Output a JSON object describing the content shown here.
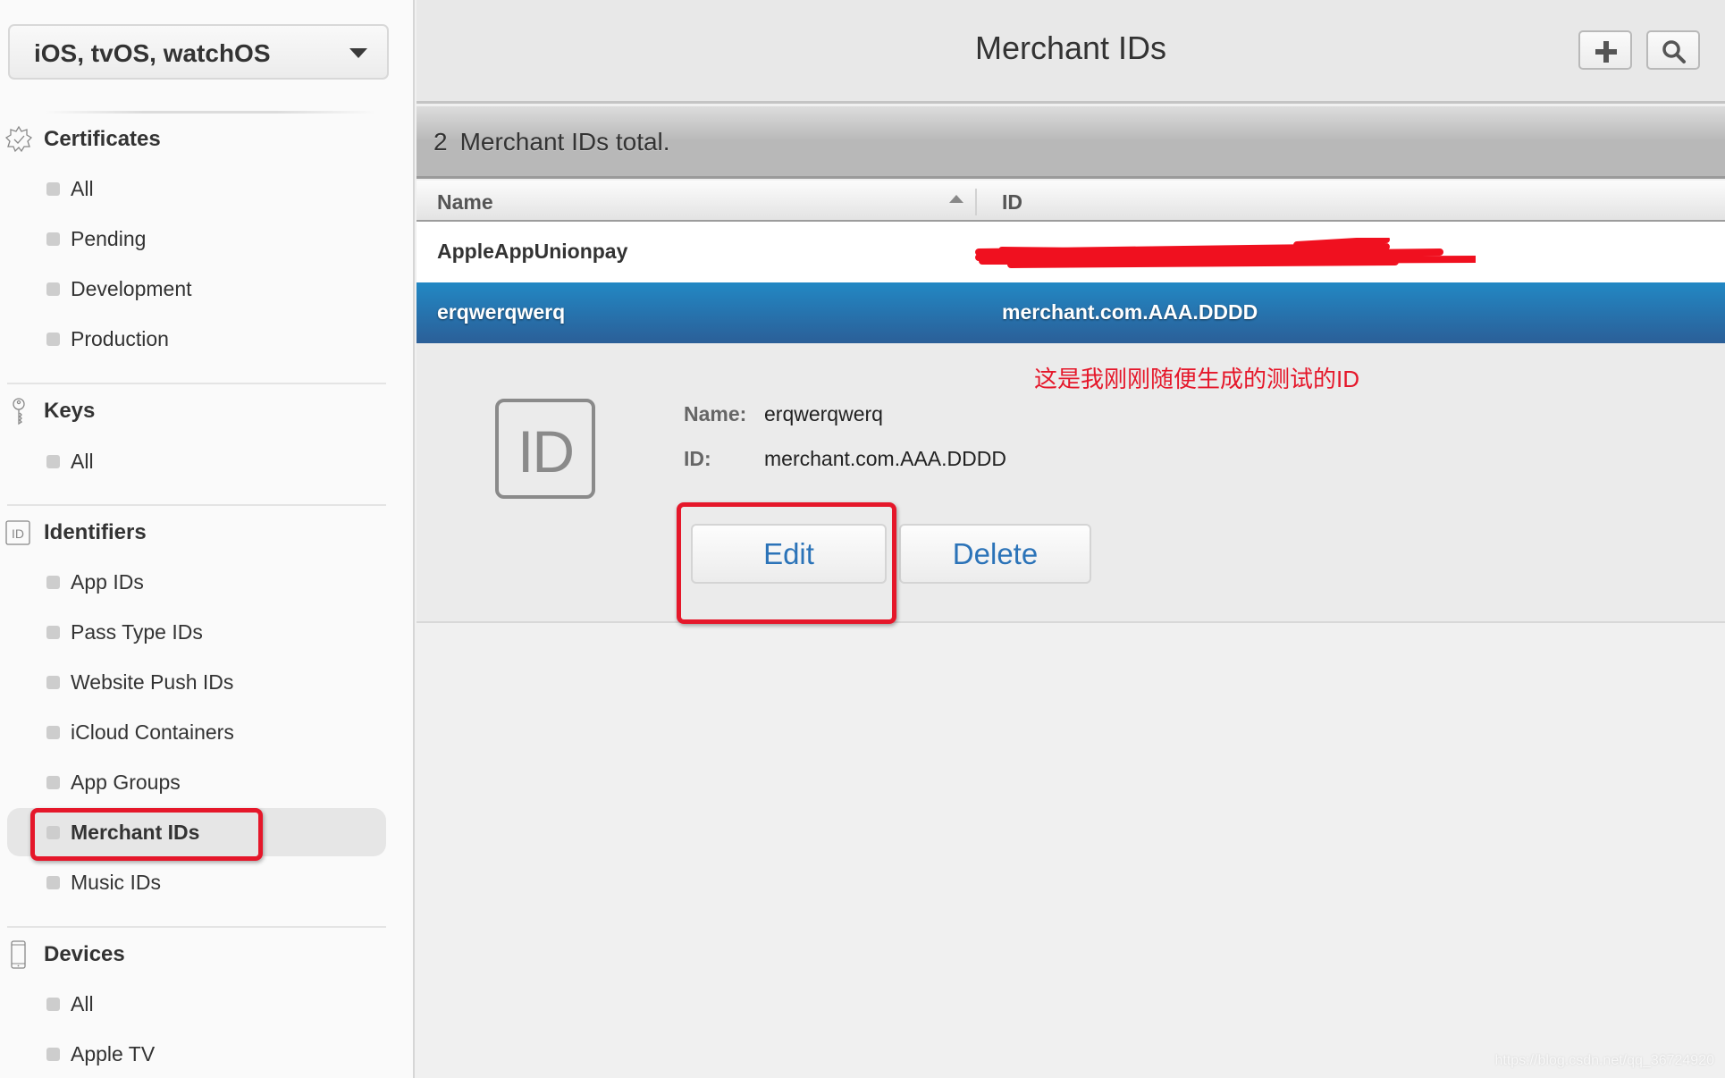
{
  "sidebar": {
    "platform_select": {
      "value": "iOS, tvOS, watchOS"
    },
    "sections": [
      {
        "title": "Certificates",
        "icon": "certificate-badge-icon",
        "items": [
          "All",
          "Pending",
          "Development",
          "Production"
        ]
      },
      {
        "title": "Keys",
        "icon": "key-icon",
        "items": [
          "All"
        ]
      },
      {
        "title": "Identifiers",
        "icon": "id-icon",
        "items": [
          "App IDs",
          "Pass Type IDs",
          "Website Push IDs",
          "iCloud Containers",
          "App Groups",
          "Merchant IDs",
          "Music IDs"
        ]
      },
      {
        "title": "Devices",
        "icon": "device-phone-icon",
        "items": [
          "All",
          "Apple TV"
        ]
      }
    ],
    "active_item": "Merchant IDs"
  },
  "header": {
    "title": "Merchant IDs",
    "add_icon": "plus-icon",
    "search_icon": "search-icon"
  },
  "summary": {
    "count": "2",
    "label": "Merchant IDs total."
  },
  "table": {
    "columns": [
      "Name",
      "ID"
    ],
    "sort": {
      "column": "Name",
      "direction": "ascending"
    },
    "rows": [
      {
        "name": "AppleAppUnionpay",
        "id": "[redacted]",
        "selected": false
      },
      {
        "name": "erqwerqwerq",
        "id": "merchant.com.AAA.DDDD",
        "selected": true
      }
    ]
  },
  "detail": {
    "badge": "ID",
    "name_label": "Name:",
    "name_value": "erqwerqwerq",
    "id_label": "ID:",
    "id_value": "merchant.com.AAA.DDDD",
    "edit_label": "Edit",
    "delete_label": "Delete",
    "annotation": "这是我刚刚随便生成的测试的ID"
  },
  "colors": {
    "selection_top": "#2288c4",
    "selection_bottom": "#2b5f98",
    "button_text": "#2b73b8",
    "annotation_red": "#e5172a"
  },
  "watermark": "https://blog.csdn.net/qq_36724920"
}
